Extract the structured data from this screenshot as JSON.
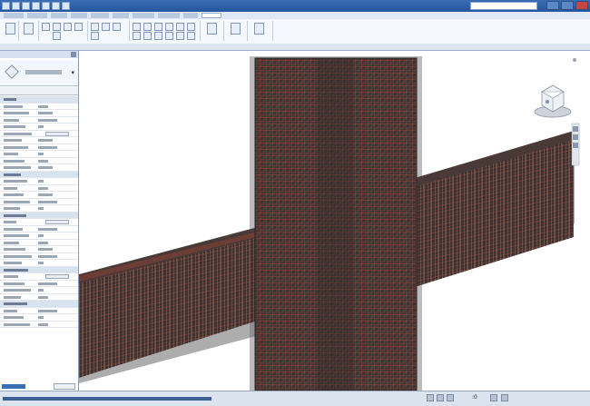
{
  "app": {
    "title_bar_text_visible": false
  },
  "ribbon": {
    "groups": [
      "select",
      "properties",
      "clipboard",
      "geometry",
      "modify",
      "view",
      "measure",
      "create"
    ]
  },
  "properties": {
    "type_dropdown_arrow": "▾",
    "row_groups": 7
  },
  "status": {
    "zero_value": ":0"
  },
  "viewport": {
    "background": "#ffffff",
    "rebar_color": "#7a3f35",
    "concrete_color": "#3e3635",
    "shadow_color": "#6a6a6a"
  },
  "icons": [
    "navigation-cube-icon",
    "steering-wheel-icon",
    "help-icon"
  ]
}
